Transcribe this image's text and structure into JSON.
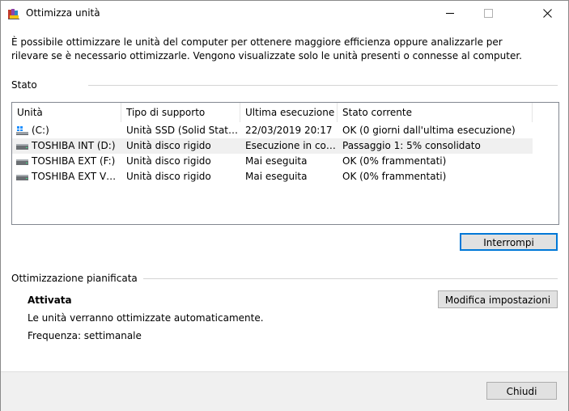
{
  "window": {
    "title": "Ottimizza unità"
  },
  "description": "È possibile ottimizzare le unità del computer per ottenere maggiore efficienza oppure analizzarle per rilevare se è necessario ottimizzarle. Vengono visualizzate solo le unità presenti o connesse al computer.",
  "status": {
    "label": "Stato",
    "columns": [
      "Unità",
      "Tipo di supporto",
      "Ultima esecuzione",
      "Stato corrente"
    ],
    "rows": [
      {
        "drive": "(C:)",
        "icon": "windows-drive-icon",
        "type": "Unità SSD (Solid State D...",
        "last_run": "22/03/2019 20:17",
        "state": "OK (0 giorni dall'ultima esecuzione)"
      },
      {
        "drive": "TOSHIBA INT (D:)",
        "icon": "hard-drive-icon",
        "type": "Unità disco rigido",
        "last_run": "Esecuzione in cors...",
        "state": "Passaggio 1: 5% consolidato"
      },
      {
        "drive": "TOSHIBA EXT (F:)",
        "icon": "hard-drive-icon",
        "type": "Unità disco rigido",
        "last_run": "Mai eseguita",
        "state": "OK (0% frammentati)"
      },
      {
        "drive": "TOSHIBA EXT VEC...",
        "icon": "hard-drive-icon",
        "type": "Unità disco rigido",
        "last_run": "Mai eseguita",
        "state": "OK (0% frammentati)"
      }
    ],
    "stop_button": "Interrompi"
  },
  "schedule": {
    "label": "Ottimizzazione pianificata",
    "state": "Attivata",
    "line1": "Le unità verranno ottimizzate automaticamente.",
    "line2": "Frequenza: settimanale",
    "change_button": "Modifica impostazioni"
  },
  "footer": {
    "close_button": "Chiudi"
  },
  "colors": {
    "focus_border": "#0078d7",
    "button_bg": "#e1e1e1",
    "footer_bg": "#f0f0f0"
  }
}
